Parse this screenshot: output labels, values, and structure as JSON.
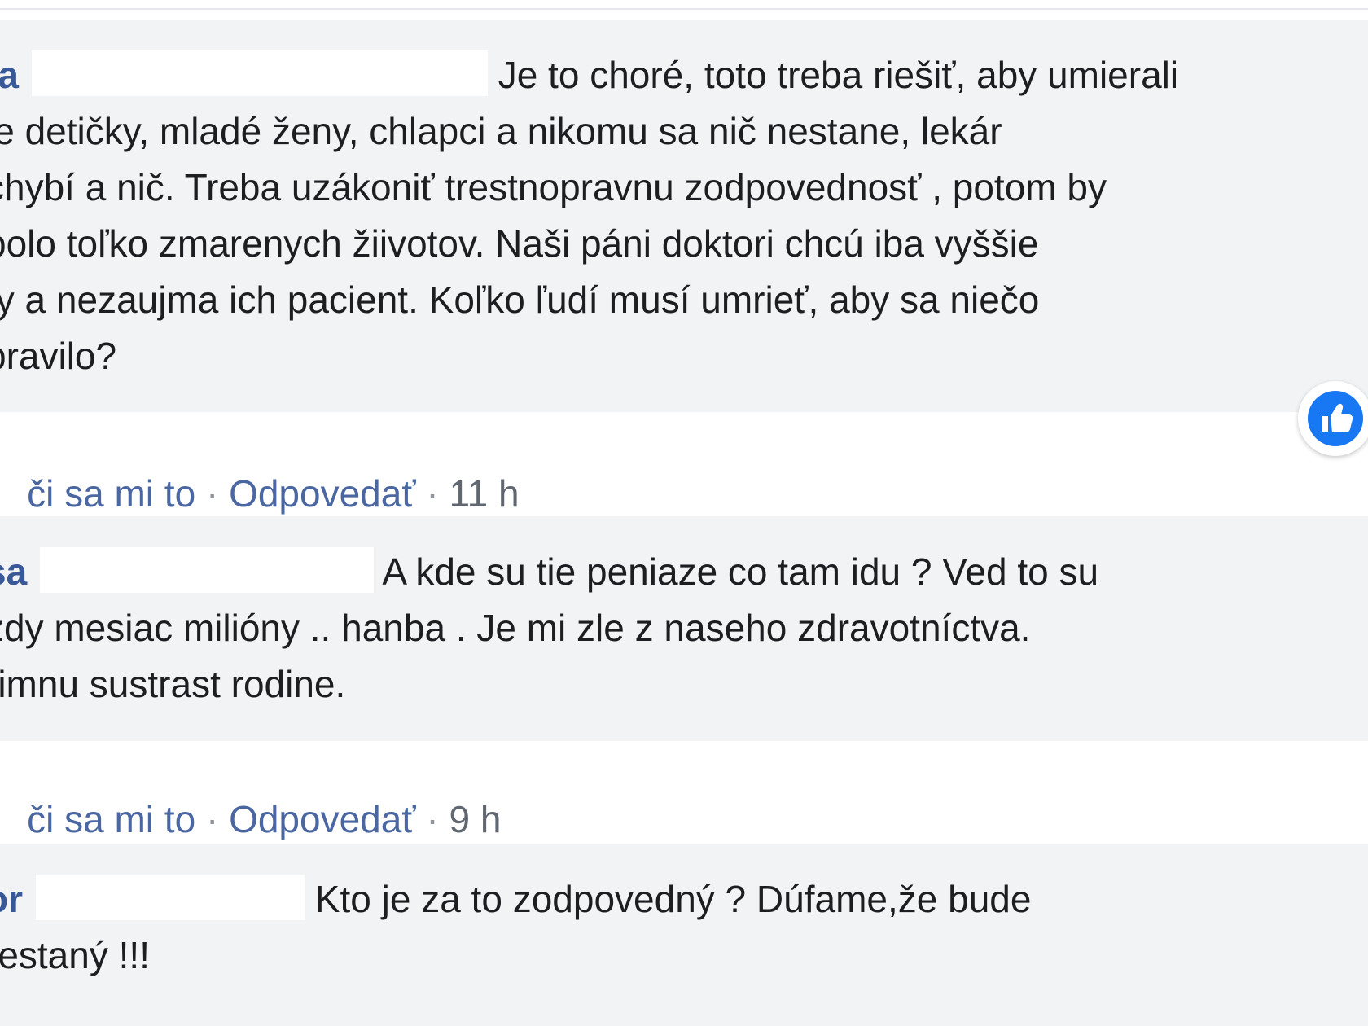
{
  "comments": [
    {
      "author": "ta",
      "lines": [
        "Je to choré, toto treba riešiť, aby umierali",
        "le detičky, mladé ženy, chlapci a nikomu sa nič nestane, lekár",
        "chybí a nič. Treba uzákoniť trestnopravnu zodpovednosť , potom by",
        "bolo toľko zmarenych žiivotov. Naši páni doktori chcú iba vyššie",
        "ty a nezaujma ich pacient. Koľko ľudí musí umrieť, aby sa niečo",
        "pravilo?"
      ],
      "like": "či sa mi to",
      "reply": "Odpovedať",
      "time": "11 h",
      "reaction_icon": "like-icon"
    },
    {
      "author": "sa",
      "lines": [
        "A kde su tie peniaze co tam idu ? Ved to su",
        "zdy mesiac milióny .. hanba . Je mi zle z naseho zdravotníctva.",
        "rimnu sustrast rodine."
      ],
      "like": "či sa mi to",
      "reply": "Odpovedať",
      "time": "9 h"
    },
    {
      "author": "or",
      "lines": [
        "Kto je za to zodpovedný ? Dúfame,že bude",
        "restaný !!!"
      ]
    }
  ],
  "separator": "·",
  "colors": {
    "bubble": "#f2f3f5",
    "author": "#385898",
    "link": "#4b67a1",
    "text": "#1c1e21",
    "like_blue": "#1877f2"
  }
}
